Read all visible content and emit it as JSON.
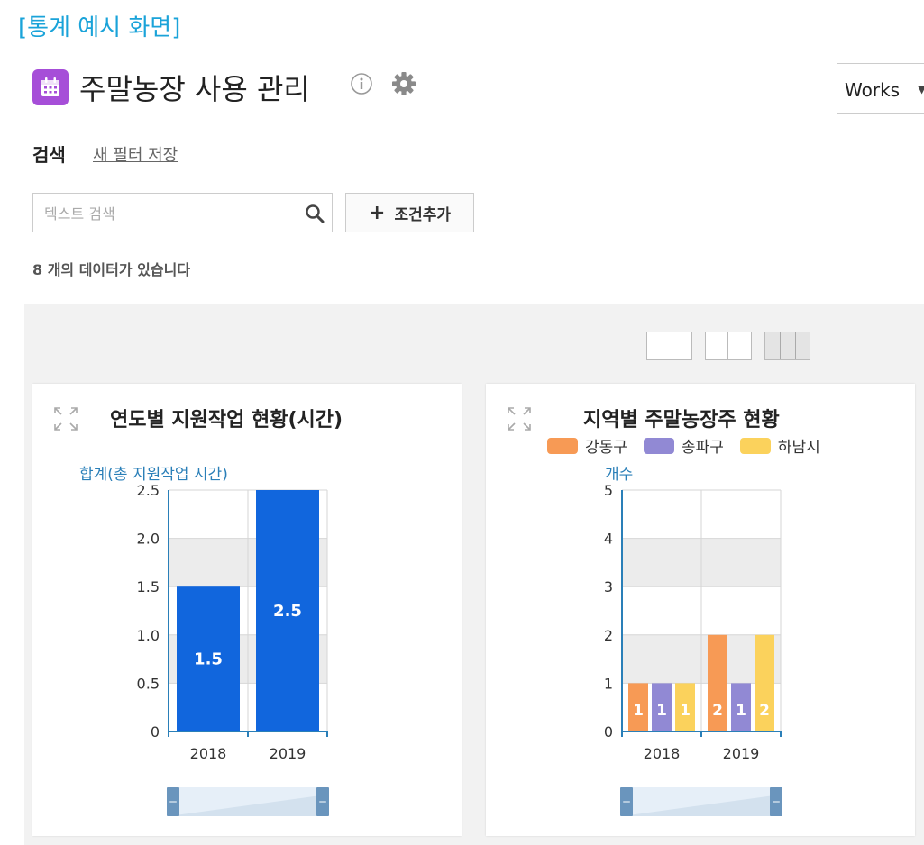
{
  "caption": "[통계 예시 화면]",
  "app": {
    "title": "주말농장 사용 관리",
    "icon": "calendar-icon",
    "icon_color": "#a64ed8"
  },
  "workspace": {
    "selected": "Works"
  },
  "search": {
    "label": "검색",
    "save_filter": "새 필터 저장",
    "placeholder": "텍스트 검색",
    "value": "",
    "add_condition": "조건추가"
  },
  "result_count": "8 개의 데이터가 있습니다",
  "layout_options": [
    "single-column",
    "two-column",
    "three-column"
  ],
  "chart_data": [
    {
      "type": "bar",
      "title": "연도별 지원작업 현황(시간)",
      "ylabel": "합계(총 지원작업 시간)",
      "xlabel": "",
      "categories": [
        "2018",
        "2019"
      ],
      "series": [
        {
          "values": [
            1.5,
            2.5
          ],
          "color": "#1166dd"
        }
      ],
      "yticks": [
        "0",
        "0.5",
        "1.0",
        "1.5",
        "2.0",
        "2.5"
      ],
      "ylim": [
        0,
        2.5
      ],
      "grid": true,
      "data_labels": true
    },
    {
      "type": "bar",
      "title": "지역별 주말농장주 현황",
      "ylabel": "개수",
      "xlabel": "",
      "categories": [
        "2018",
        "2019"
      ],
      "series": [
        {
          "name": "강동구",
          "values": [
            1,
            2
          ],
          "color": "#f79a55"
        },
        {
          "name": "송파구",
          "values": [
            1,
            1
          ],
          "color": "#9189d4"
        },
        {
          "name": "하남시",
          "values": [
            1,
            2
          ],
          "color": "#fbd25c"
        }
      ],
      "yticks": [
        "0",
        "1",
        "2",
        "3",
        "4",
        "5"
      ],
      "ylim": [
        0,
        5
      ],
      "grid": true,
      "legend": "top",
      "data_labels": true
    }
  ],
  "colors": {
    "accent": "#1aa3d9",
    "axis": "#2a7fb8",
    "grid_band": "#ececec",
    "scroller": "#6a95bd"
  }
}
